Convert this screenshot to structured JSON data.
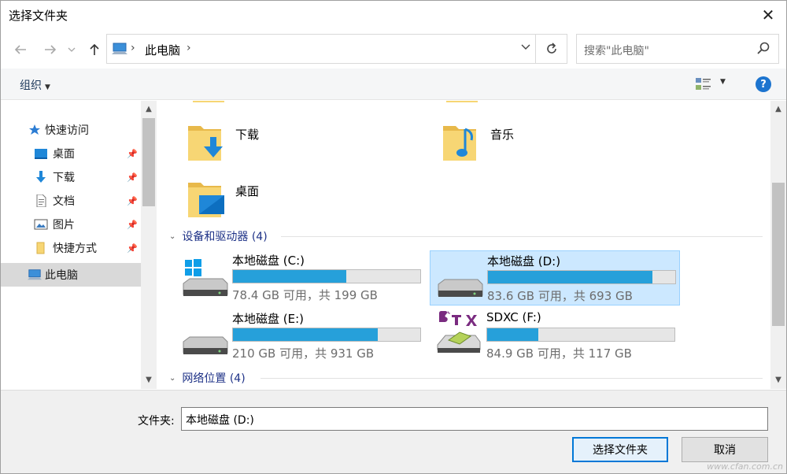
{
  "window": {
    "title": "选择文件夹",
    "close_label": "✕"
  },
  "nav": {
    "back_icon": "arrow-left-icon",
    "forward_icon": "arrow-right-icon",
    "recent_icon": "chevron-down-icon",
    "up_icon": "arrow-up-icon",
    "address": {
      "location": "此电脑"
    },
    "refresh_icon": "refresh-icon",
    "search": {
      "placeholder": "搜索\"此电脑\""
    }
  },
  "toolbar": {
    "organize_label": "组织",
    "help_label": "?"
  },
  "sidebar": {
    "items": [
      {
        "label": "快速访问",
        "icon": "star-icon",
        "pinned": false
      },
      {
        "label": "桌面",
        "icon": "desktop-icon",
        "pinned": true
      },
      {
        "label": "下载",
        "icon": "download-icon",
        "pinned": true
      },
      {
        "label": "文档",
        "icon": "document-icon",
        "pinned": true
      },
      {
        "label": "图片",
        "icon": "picture-icon",
        "pinned": true
      },
      {
        "label": "快捷方式",
        "icon": "folder-icon",
        "pinned": true
      },
      {
        "label": "此电脑",
        "icon": "computer-icon",
        "selected": true
      }
    ]
  },
  "main": {
    "folders": [
      {
        "label": "下载",
        "icon": "download-folder-icon"
      },
      {
        "label": "音乐",
        "icon": "music-folder-icon"
      },
      {
        "label": "桌面",
        "icon": "desktop-folder-icon"
      }
    ],
    "sections": [
      {
        "label": "设备和驱动器 (4)"
      },
      {
        "label": "网络位置 (4)"
      }
    ],
    "drives": [
      {
        "name": "本地磁盘 (C:)",
        "info": "78.4 GB 可用，共 199 GB",
        "used_fraction": 0.606,
        "icon": "windows-drive-icon"
      },
      {
        "name": "本地磁盘 (D:)",
        "info": "83.6 GB 可用，共 693 GB",
        "used_fraction": 0.879,
        "icon": "hard-drive-icon",
        "selected": true
      },
      {
        "name": "本地磁盘 (E:)",
        "info": "210 GB 可用，共 931 GB",
        "used_fraction": 0.774,
        "icon": "hard-drive-icon"
      },
      {
        "name": "SDXC (F:)",
        "info": "84.9 GB 可用，共 117 GB",
        "used_fraction": 0.274,
        "icon": "sdxc-card-icon"
      }
    ]
  },
  "footer": {
    "folder_label": "文件夹:",
    "folder_value": "本地磁盘 (D:)",
    "select_button": "选择文件夹",
    "cancel_button": "取消"
  },
  "colors": {
    "accent": "#0078d7",
    "drive_bar": "#26a0da",
    "selection": "#cce8ff",
    "folder": "#f7d674"
  },
  "watermark": "www.cfan.com.cn"
}
